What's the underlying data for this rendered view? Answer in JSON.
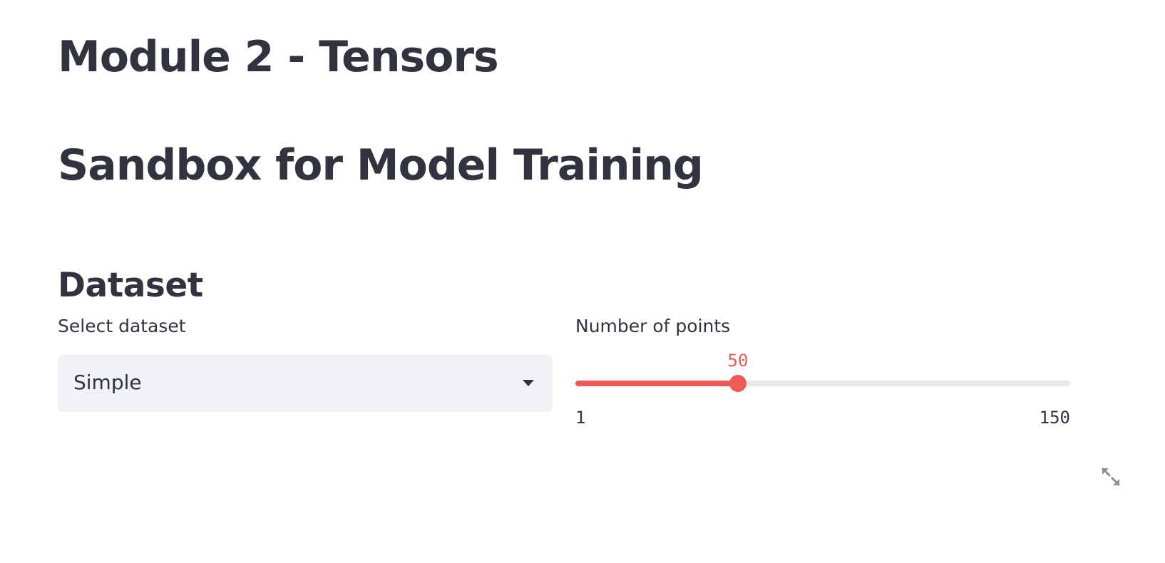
{
  "header": {
    "title": "Module 2 - Tensors",
    "subtitle": "Sandbox for Model Training"
  },
  "dataset_section": {
    "heading": "Dataset",
    "select": {
      "label": "Select dataset",
      "value": "Simple"
    },
    "slider": {
      "label": "Number of points",
      "value": 50,
      "value_text": "50",
      "min": 1,
      "min_text": "1",
      "max": 150,
      "max_text": "150",
      "accent_color": "#ee5a56"
    }
  },
  "icons": {
    "select_caret": "chevron-down-icon",
    "fullscreen": "fullscreen-expand-icon"
  }
}
